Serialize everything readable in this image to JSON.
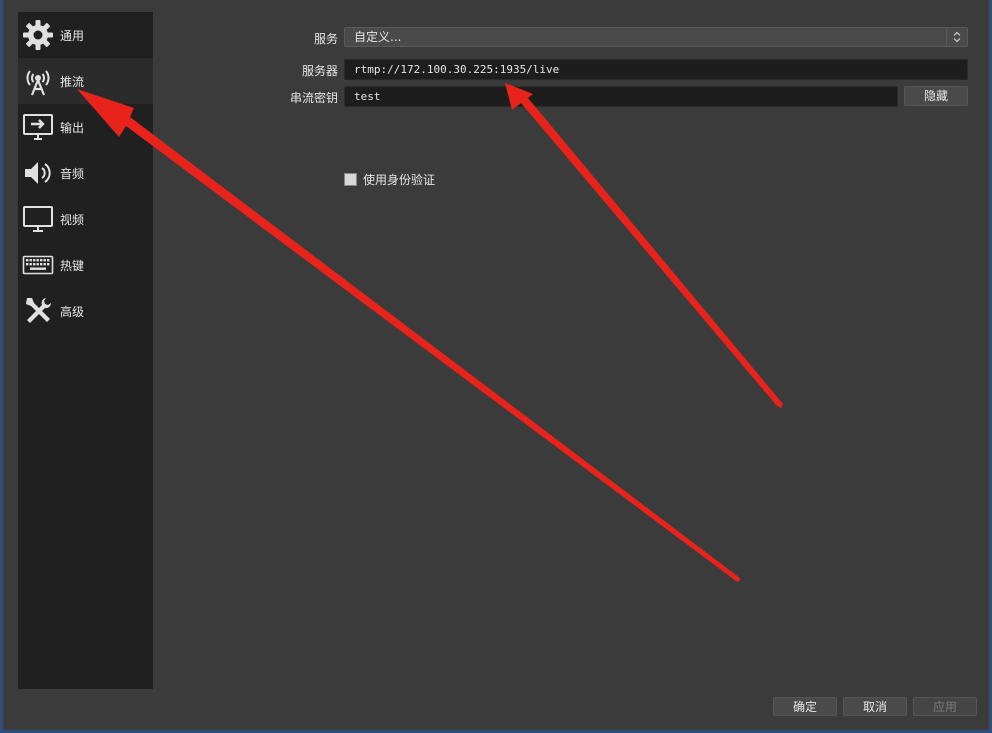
{
  "sidebar": {
    "items": [
      {
        "label": "通用",
        "icon": "gear-icon",
        "active": false
      },
      {
        "label": "推流",
        "icon": "antenna-icon",
        "active": true
      },
      {
        "label": "输出",
        "icon": "output-icon",
        "active": false
      },
      {
        "label": "音频",
        "icon": "speaker-icon",
        "active": false
      },
      {
        "label": "视频",
        "icon": "monitor-icon",
        "active": false
      },
      {
        "label": "热键",
        "icon": "keyboard-icon",
        "active": false
      },
      {
        "label": "高级",
        "icon": "tools-icon",
        "active": false
      }
    ]
  },
  "stream": {
    "service_label": "服务",
    "service_value": "自定义...",
    "server_label": "服务器",
    "server_value": "rtmp://172.100.30.225:1935/live",
    "key_label": "串流密钥",
    "key_value": "test",
    "hide_button": "隐藏",
    "auth_checkbox_label": "使用身份验证",
    "auth_checked": false
  },
  "footer": {
    "ok_label": "确定",
    "cancel_label": "取消",
    "apply_label": "应用"
  },
  "colors": {
    "annotation_arrow": "#e8231c",
    "sidebar_bg": "#202020",
    "content_bg": "#3b3b3b"
  }
}
